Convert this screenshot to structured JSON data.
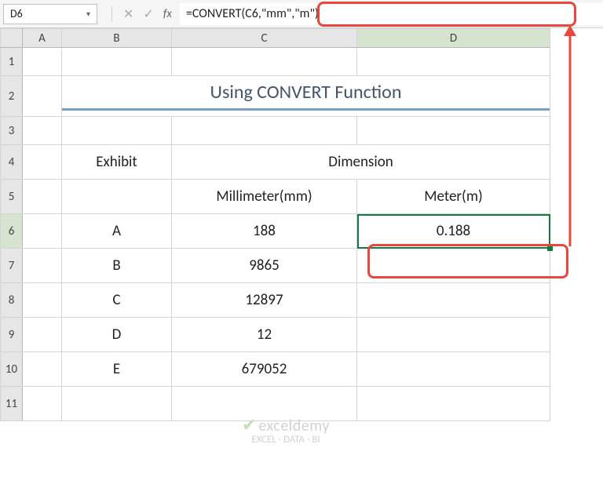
{
  "toolbar": {
    "namebox": "D6",
    "formula": "=CONVERT(C6,\"mm\",\"m\")",
    "fx_label": "fx",
    "cancel_glyph": "✕",
    "check_glyph": "✓",
    "dropdown_glyph": "▾"
  },
  "columns": [
    "A",
    "B",
    "C",
    "D"
  ],
  "rows": [
    "1",
    "2",
    "3",
    "4",
    "5",
    "6",
    "7",
    "8",
    "9",
    "10",
    "11"
  ],
  "title": "Using CONVERT Function",
  "table": {
    "header_exhibit": "Exhibit",
    "header_dimension": "Dimension",
    "sub_mm": "Millimeter(mm)",
    "sub_m": "Meter(m)",
    "data": [
      {
        "exhibit": "A",
        "mm": "188",
        "m": "0.188"
      },
      {
        "exhibit": "B",
        "mm": "9865",
        "m": ""
      },
      {
        "exhibit": "C",
        "mm": "12897",
        "m": ""
      },
      {
        "exhibit": "D",
        "mm": "12",
        "m": ""
      },
      {
        "exhibit": "E",
        "mm": "679052",
        "m": ""
      }
    ]
  },
  "watermark": {
    "brand": "exceldemy",
    "tagline": "EXCEL · DATA · BI"
  },
  "chart_data": {
    "type": "table",
    "title": "Using CONVERT Function",
    "columns": [
      "Exhibit",
      "Millimeter(mm)",
      "Meter(m)"
    ],
    "rows": [
      [
        "A",
        188,
        0.188
      ],
      [
        "B",
        9865,
        null
      ],
      [
        "C",
        12897,
        null
      ],
      [
        "D",
        12,
        null
      ],
      [
        "E",
        679052,
        null
      ]
    ]
  }
}
